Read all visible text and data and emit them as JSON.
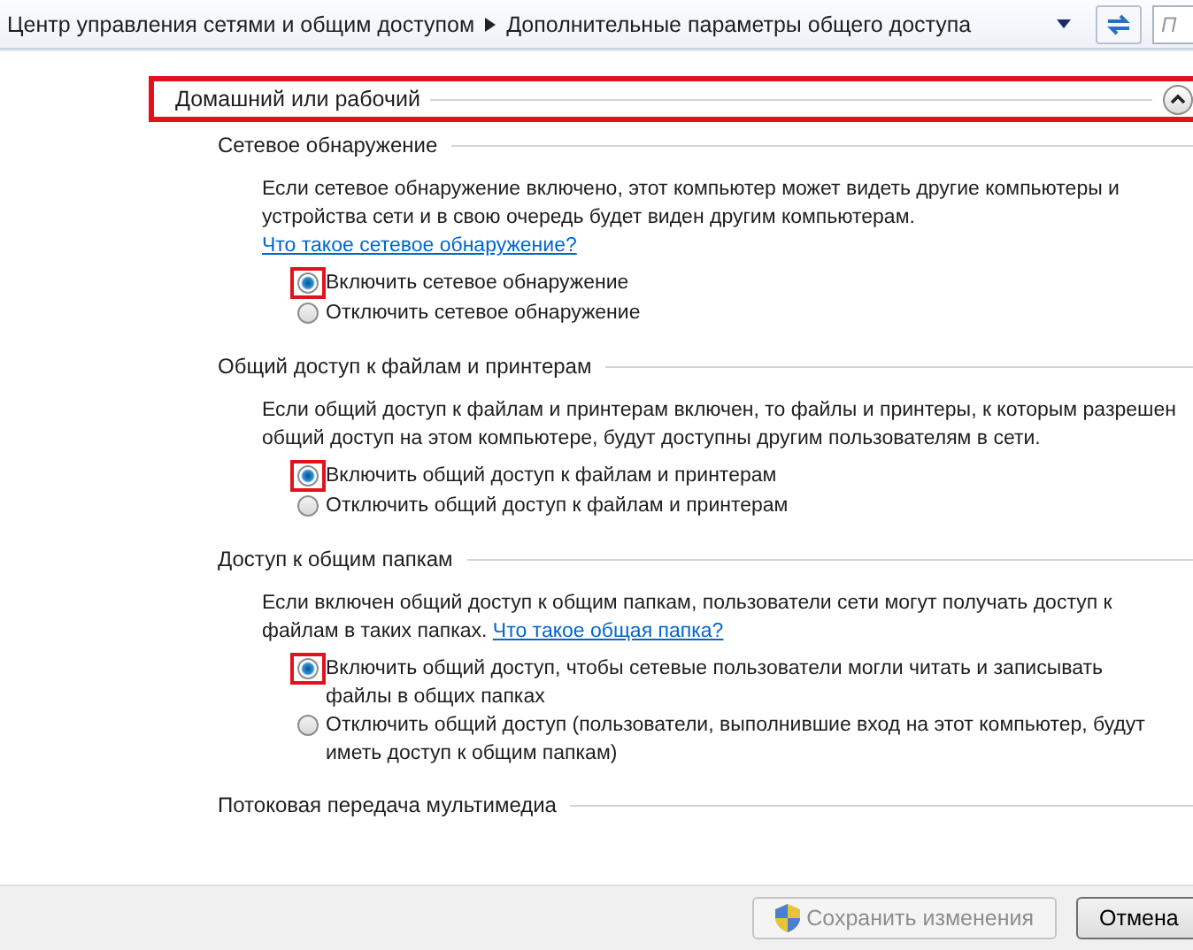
{
  "address_bar": {
    "breadcrumbs": [
      {
        "label": "Центр управления сетями и общим доступом"
      },
      {
        "label": "Дополнительные параметры общего доступа"
      }
    ],
    "search": {
      "placeholder": "П"
    }
  },
  "profile": {
    "title": "Домашний или рабочий",
    "expanded": true,
    "highlighted": true
  },
  "sections": [
    {
      "title": "Сетевое обнаружение",
      "description": "Если сетевое обнаружение включено, этот компьютер может видеть другие компьютеры и устройства сети и в свою очередь будет виден другим компьютерам.",
      "link": "Что такое сетевое обнаружение?",
      "options": [
        {
          "label": "Включить сетевое обнаружение",
          "selected": true,
          "highlighted": true
        },
        {
          "label": "Отключить сетевое обнаружение",
          "selected": false,
          "highlighted": false
        }
      ]
    },
    {
      "title": "Общий доступ к файлам и принтерам",
      "description": "Если общий доступ к файлам и принтерам включен, то файлы и принтеры, к которым разрешен общий доступ на этом компьютере, будут доступны другим пользователям в сети.",
      "options": [
        {
          "label": "Включить общий доступ к файлам и принтерам",
          "selected": true,
          "highlighted": true
        },
        {
          "label": "Отключить общий доступ к файлам и принтерам",
          "selected": false,
          "highlighted": false
        }
      ]
    },
    {
      "title": "Доступ к общим папкам",
      "description": "Если включен общий доступ к общим папкам, пользователи сети могут получать доступ к файлам в таких папках.",
      "link": "Что такое общая папка?",
      "options": [
        {
          "label": "Включить общий доступ, чтобы сетевые пользователи могли читать и записывать файлы в общих папках",
          "selected": true,
          "highlighted": true
        },
        {
          "label": "Отключить общий доступ (пользователи, выполнившие вход на этот компьютер, будут иметь доступ к общим папкам)",
          "selected": false,
          "highlighted": false
        }
      ]
    },
    {
      "title": "Потоковая передача мультимедиа"
    }
  ],
  "footer": {
    "buttons": [
      {
        "label": "Сохранить изменения",
        "kind": "shield",
        "disabled": true
      },
      {
        "label": "Отмена",
        "kind": "plain",
        "disabled": false
      }
    ]
  }
}
